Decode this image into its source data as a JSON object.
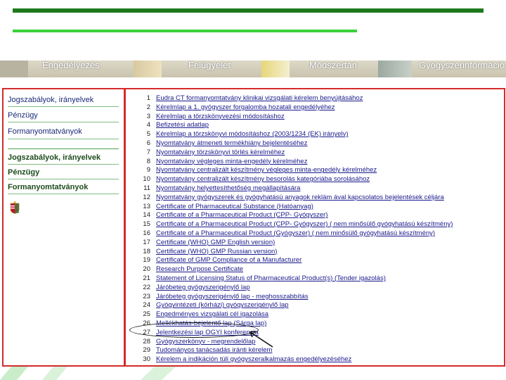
{
  "nav": {
    "items": [
      "Engedélyezés",
      "Felügyelet",
      "Módszertan",
      "Gyógyszerinformáció"
    ]
  },
  "sidebar": {
    "top_links": [
      "Jogszabályok, irányelvek",
      "Pénzügy",
      "Formanyomtatványok"
    ],
    "bold_links": [
      "Jogszabályok, irányelvek",
      "Pénzügy",
      "Formanyomtatványok"
    ]
  },
  "documents": [
    {
      "n": "1",
      "t": "Eudra CT formanyomtatvány klinikai vizsgálati kérelem benyújtásához"
    },
    {
      "n": "2",
      "t": "Kérelmlap a 1. gyógyszer forgalomba hozatali engedélyéhez"
    },
    {
      "n": "3",
      "t": "Kérelmlap a törzskönyvezési módosításhoz"
    },
    {
      "n": "4",
      "t": "Befizetési adatlap"
    },
    {
      "n": "5",
      "t": "Kérelmlap a törzskönyvi módosításhoz (2003/1234 (EK) irányelv)"
    },
    {
      "n": "6",
      "t": "Nyomtatvány átmeneti termékhiány bejelentéséhez"
    },
    {
      "n": "7",
      "t": "Nyomtatvány törzskönyvi törlés kérelméhez"
    },
    {
      "n": "8",
      "t": "Nyomtatvány végleges minta-engedély kérelméhez"
    },
    {
      "n": "9",
      "t": "Nyomtatvány centralizált készítmény végleges minta-engedély kérelméhez"
    },
    {
      "n": "10",
      "t": "Nyomtatvány centralizált készítmény besorolás kategóriába sorolásához"
    },
    {
      "n": "11",
      "t": "Nyomtatvány helyettesíthetőség megállapítására"
    },
    {
      "n": "12",
      "t": "Nyomtatvány gyógyszerek és gyógyhatású anyagok reklám ával kapcsolatos bejelentések céljára"
    },
    {
      "n": "13",
      "t": "Certificate of Pharmaceutical Substance (Hatóanyag)"
    },
    {
      "n": "14",
      "t": "Certificate of a Pharmaceutical Product (CPP- Gyógyszer)"
    },
    {
      "n": "15",
      "t": "Certificate of a Pharmaceutical Product (CPP- Gyógyszer) ( nem minősülő gyógyhatású készítmény)"
    },
    {
      "n": "16",
      "t": "Certificate of a Pharmaceutical Product (Gyógyszer) ( nem minősülő gyógyhatású készítmény)"
    },
    {
      "n": "17",
      "t": "Certificate (WHO) GMP English version)"
    },
    {
      "n": "18",
      "t": "Certificate (WHO) GMP Russian version)"
    },
    {
      "n": "19",
      "t": "Certificate of GMP Compliance of a Manufacturer"
    },
    {
      "n": "20",
      "t": "Research Purpose Certificate"
    },
    {
      "n": "21",
      "t": "Statement of Licensing Status of Pharmaceutical Product(s) (Tender igazolás)"
    },
    {
      "n": "22",
      "t": "Járóbeteg gyógyszerigénylő lap"
    },
    {
      "n": "23",
      "t": "Járóbeteg gyógyszerigénylő lap - meghosszabbítás"
    },
    {
      "n": "24",
      "t": "Gyógyintézeti (kórházi) gyógyszerigénylő lap"
    },
    {
      "n": "25",
      "t": "Engedményes vizsgálati cél igazolása"
    },
    {
      "n": "26",
      "t": "Mellékhatás-bejelentő lap (Sárga lap)"
    },
    {
      "n": "27",
      "t": "Jelentkezési lap OGYI konferencia"
    },
    {
      "n": "28",
      "t": "Gyógyszerkönyv - megrendelőlap"
    },
    {
      "n": "29",
      "t": "Tudományos tanácsadás iránti kérelem"
    },
    {
      "n": "30",
      "t": "Kérelem a indikáción túli gyógyszeralkalmazás engedélyezéséhez"
    }
  ],
  "colors": {
    "dark_green": "#1d7a1d",
    "light_green": "#3ad13a",
    "frame_red": "#d42b2b",
    "link_blue": "#1a1a8c"
  }
}
